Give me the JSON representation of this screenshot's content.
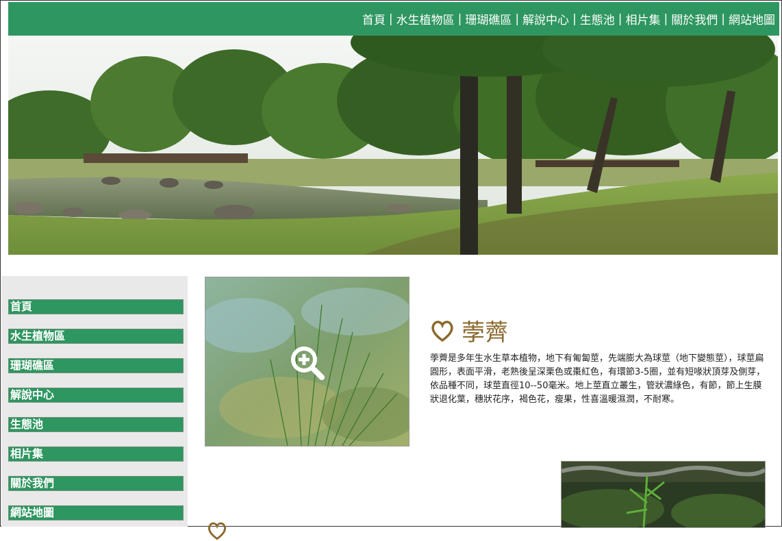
{
  "topnav": {
    "items": [
      "首頁",
      "水生植物區",
      "珊瑚礁區",
      "解說中心",
      "生態池",
      "相片集",
      "關於我們",
      "網站地圖"
    ],
    "separator": "|"
  },
  "sidebar": {
    "items": [
      "首頁",
      "水生植物區",
      "珊瑚礁區",
      "解說中心",
      "生態池",
      "相片集",
      "關於我們",
      "網站地圖"
    ]
  },
  "entry": {
    "title": "荸薺",
    "description": "荸薺是多年生水生草本植物，地下有匍匐莖，先端膨大為球莖（地下變態莖），球莖扁圓形，表面平滑，老熟後呈深栗色或棗紅色，有環節3-5圈，並有短喙狀頂芽及側芽，依品種不同，球莖直徑10--50毫米。地上莖直立叢生，管狀濃綠色，有節，節上生膜狀退化葉，穗狀花序，褐色花，瘦果，性喜溫暖濕潤，不耐寒。"
  },
  "colors": {
    "brand_green": "#2e9660",
    "title_brown": "#8b6a2f",
    "sidebar_bg": "#e9e9e9"
  },
  "icons": {
    "zoom": "zoom-in-icon",
    "heart": "heart-outline-icon"
  }
}
